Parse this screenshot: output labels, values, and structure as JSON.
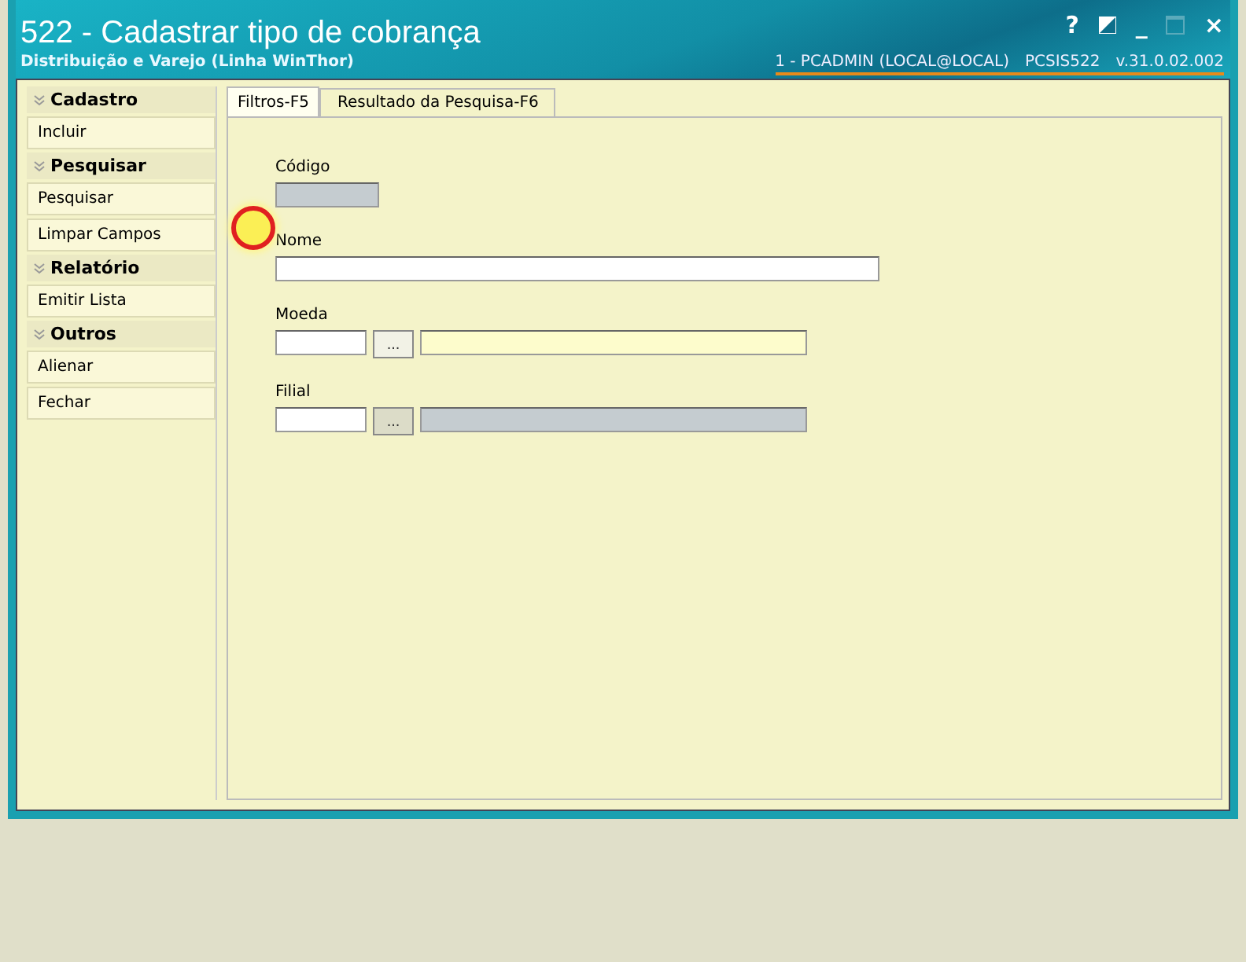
{
  "window": {
    "title": "522 - Cadastrar tipo de cobrança",
    "subtitle": "Distribuição e Varejo (Linha WinThor)",
    "controls": [
      "?",
      "_",
      "×"
    ],
    "session": "1 - PCADMIN (LOCAL@LOCAL)",
    "program": "PCSIS522",
    "version": "v.31.0.02.002"
  },
  "sidebar": [
    {
      "title": "Cadastro",
      "items": [
        "Incluir"
      ]
    },
    {
      "title": "Pesquisar",
      "items": [
        "Pesquisar",
        "Limpar Campos"
      ]
    },
    {
      "title": "Relatório",
      "items": [
        "Emitir Lista"
      ]
    },
    {
      "title": "Outros",
      "items": [
        "Alienar",
        "Fechar"
      ]
    }
  ],
  "tabs": [
    {
      "label": "Filtros-F5",
      "selected": true
    },
    {
      "label": "Resultado da Pesquisa-F6",
      "selected": false
    }
  ],
  "fields": [
    {
      "kind": "short",
      "label": "Código",
      "disabled": true
    },
    {
      "kind": "wide",
      "label": "Nome",
      "disabled": false
    },
    {
      "kind": "lookup",
      "label": "Moeda",
      "button": "...",
      "disabled": false
    },
    {
      "kind": "lookup",
      "label": "Filial",
      "button": "...",
      "disabled": true
    }
  ]
}
